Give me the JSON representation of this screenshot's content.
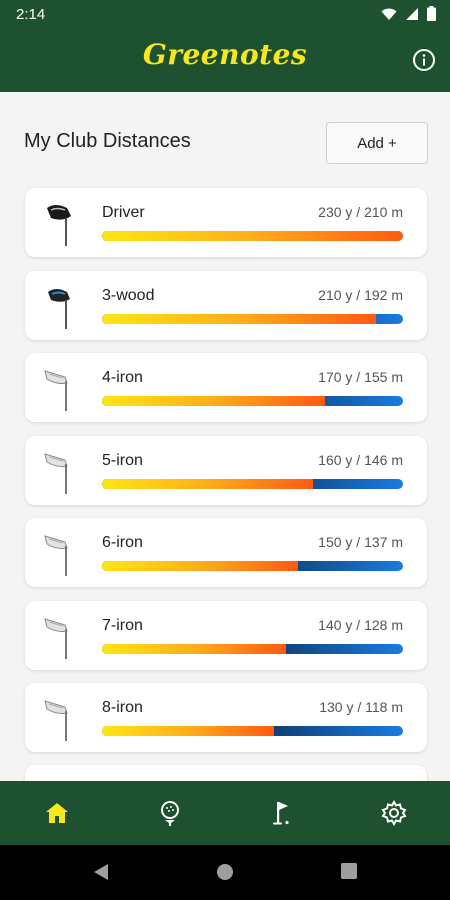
{
  "status_bar": {
    "time": "2:14"
  },
  "app": {
    "title": "Greenotes"
  },
  "page": {
    "section_title": "My Club Distances",
    "add_button_label": "Add +"
  },
  "colors": {
    "header_green": "#1d5130",
    "title_yellow": "#f6e81c",
    "nav_active": "#f6e81c"
  },
  "clubs": [
    {
      "name": "Driver",
      "distance": "230 y / 210 m",
      "icon": "driver-icon",
      "fill_percent": 100
    },
    {
      "name": "3-wood",
      "distance": "210 y / 192 m",
      "icon": "wood-icon",
      "fill_percent": 91
    },
    {
      "name": "4-iron",
      "distance": "170 y / 155 m",
      "icon": "iron-icon",
      "fill_percent": 74
    },
    {
      "name": "5-iron",
      "distance": "160 y / 146 m",
      "icon": "iron-icon",
      "fill_percent": 70
    },
    {
      "name": "6-iron",
      "distance": "150 y / 137 m",
      "icon": "iron-icon",
      "fill_percent": 65
    },
    {
      "name": "7-iron",
      "distance": "140 y / 128 m",
      "icon": "iron-icon",
      "fill_percent": 61
    },
    {
      "name": "8-iron",
      "distance": "130 y / 118 m",
      "icon": "iron-icon",
      "fill_percent": 57
    }
  ],
  "bottom_nav": [
    {
      "name": "home-icon",
      "active": true
    },
    {
      "name": "golf-ball-tee-icon",
      "active": false
    },
    {
      "name": "golf-flag-icon",
      "active": false
    },
    {
      "name": "gear-icon",
      "active": false
    }
  ],
  "system_nav": [
    "back-icon",
    "home-circle-icon",
    "recents-icon"
  ]
}
